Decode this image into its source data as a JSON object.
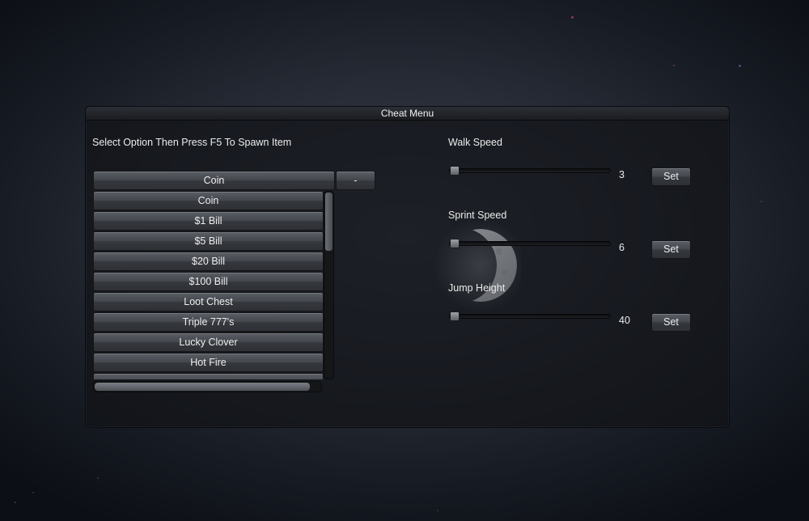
{
  "window": {
    "title": "Cheat Menu"
  },
  "spawn": {
    "instruction": "Select Option Then Press F5 To Spawn Item",
    "selected": "Coin",
    "toggle_label": "-",
    "items": [
      "Coin",
      "$1 Bill",
      "$5 Bill",
      "$20 Bill",
      "$100 Bill",
      "Loot Chest",
      "Triple 777's",
      "Lucky Clover",
      "Hot Fire"
    ],
    "vertical_scroll_position": 0,
    "horizontal_scroll_position": 0
  },
  "settings": [
    {
      "label": "Walk Speed",
      "value": "3",
      "slider_fraction": 0.0,
      "set_label": "Set"
    },
    {
      "label": "Sprint Speed",
      "value": "6",
      "slider_fraction": 0.0,
      "set_label": "Set"
    },
    {
      "label": "Jump Height",
      "value": "40",
      "slider_fraction": 0.0,
      "set_label": "Set"
    }
  ],
  "colors": {
    "button": "#44474d",
    "panel": "#121418",
    "text": "#ececec"
  },
  "icons": {
    "moon": "crescent-moon-icon"
  }
}
